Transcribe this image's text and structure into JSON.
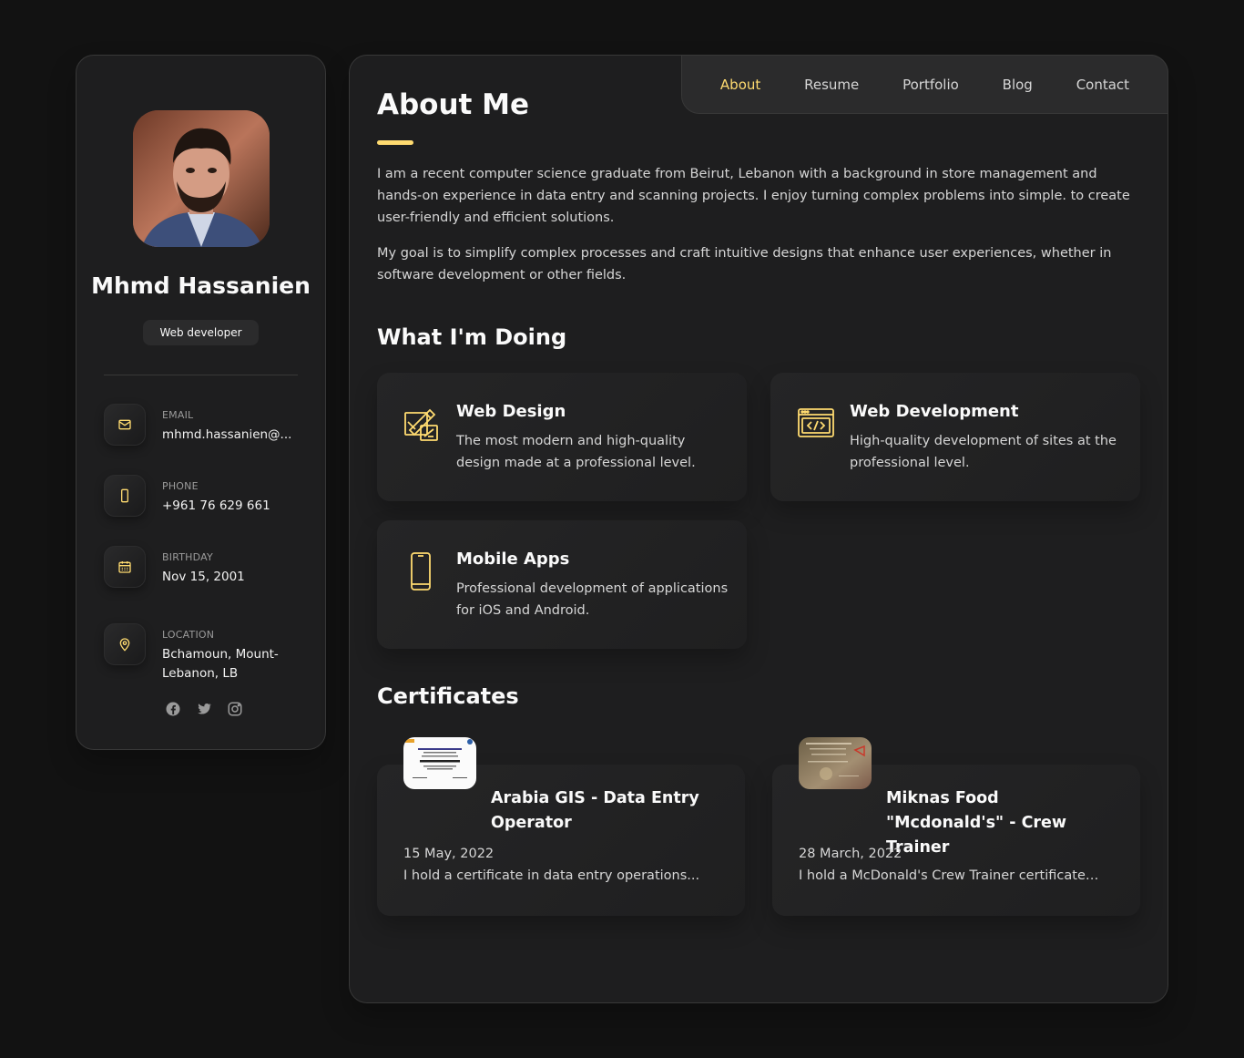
{
  "colors": {
    "accent": "#ffdb70",
    "background": "#121212",
    "card": "#1e1e1f"
  },
  "profile": {
    "name": "Mhmd Hassanien",
    "role": "Web developer",
    "contacts": [
      {
        "label": "EMAIL",
        "value": "mhmd.hassanien@...",
        "icon": "mail-icon"
      },
      {
        "label": "PHONE",
        "value": "+961 76 629 661",
        "icon": "phone-icon"
      },
      {
        "label": "BIRTHDAY",
        "value": "Nov 15, 2001",
        "icon": "calendar-icon"
      },
      {
        "label": "LOCATION",
        "value": "Bchamoun, Mount-Lebanon, LB",
        "icon": "location-icon"
      }
    ],
    "socials": [
      "facebook-icon",
      "twitter-icon",
      "instagram-icon"
    ]
  },
  "nav": {
    "items": [
      {
        "label": "About",
        "active": true
      },
      {
        "label": "Resume"
      },
      {
        "label": "Portfolio"
      },
      {
        "label": "Blog"
      },
      {
        "label": "Contact"
      }
    ]
  },
  "about": {
    "title": "About Me",
    "paragraphs": [
      "I am a recent computer science graduate from Beirut, Lebanon with a background in store management and hands-on experience in data entry and scanning projects. I enjoy turning complex problems into simple. to create user-friendly and efficient solutions.",
      "My goal is to simplify complex processes and craft intuitive designs that enhance user experiences, whether in software development or other fields."
    ]
  },
  "doing": {
    "title": "What I'm Doing",
    "services": [
      {
        "title": "Web Design",
        "text": "The most modern and high-quality design made at a professional level.",
        "icon": "design-icon"
      },
      {
        "title": "Web Development",
        "text": "High-quality development of sites at the professional level.",
        "icon": "code-icon"
      },
      {
        "title": "Mobile Apps",
        "text": "Professional development of applications for iOS and Android.",
        "icon": "mobile-icon"
      }
    ]
  },
  "certificates": {
    "title": "Certificates",
    "items": [
      {
        "title": "Arabia GIS - Data Entry Operator",
        "date": "15 May, 2022",
        "desc": "I hold a certificate in data entry operations..."
      },
      {
        "title": "Miknas Food \"Mcdonald's\" - Crew Trainer",
        "date": "28 March, 2022",
        "desc": "I hold a McDonald's Crew Trainer certificate,..."
      }
    ]
  }
}
